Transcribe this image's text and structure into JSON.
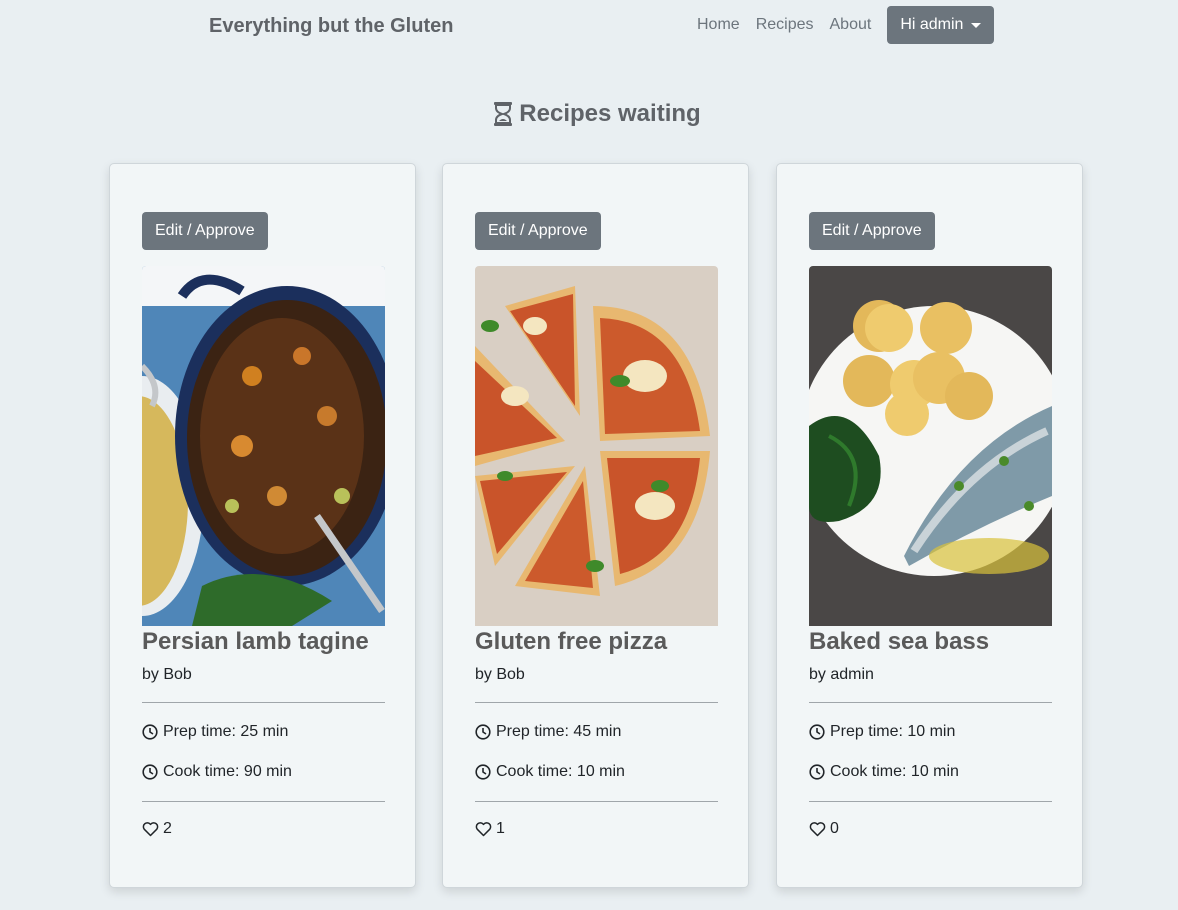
{
  "navbar": {
    "brand": "Everything but the Gluten",
    "links": [
      "Home",
      "Recipes",
      "About"
    ],
    "user_label": "Hi admin"
  },
  "page": {
    "title": "Recipes waiting"
  },
  "cards": [
    {
      "button_label": "Edit / Approve",
      "title": "Persian lamb tagine",
      "author": "by Bob",
      "prep": "Prep time: 25 min",
      "cook": "Cook time: 90 min",
      "likes": "2",
      "image": "lamb-tagine-pot-image"
    },
    {
      "button_label": "Edit / Approve",
      "title": "Gluten free pizza",
      "author": "by Bob",
      "prep": "Prep time: 45 min",
      "cook": "Cook time: 10 min",
      "likes": "1",
      "image": "pizza-image"
    },
    {
      "button_label": "Edit / Approve",
      "title": "Baked sea bass",
      "author": "by admin",
      "prep": "Prep time: 10 min",
      "cook": "Cook time: 10 min",
      "likes": "0",
      "image": "sea-bass-plate-image"
    }
  ],
  "icons": {
    "title": "hourglass-icon",
    "time": "clock-icon",
    "likes": "heart-icon"
  },
  "colors": {
    "background": "#e9eff2",
    "button": "#6c757d",
    "card": "#f2f6f7"
  }
}
